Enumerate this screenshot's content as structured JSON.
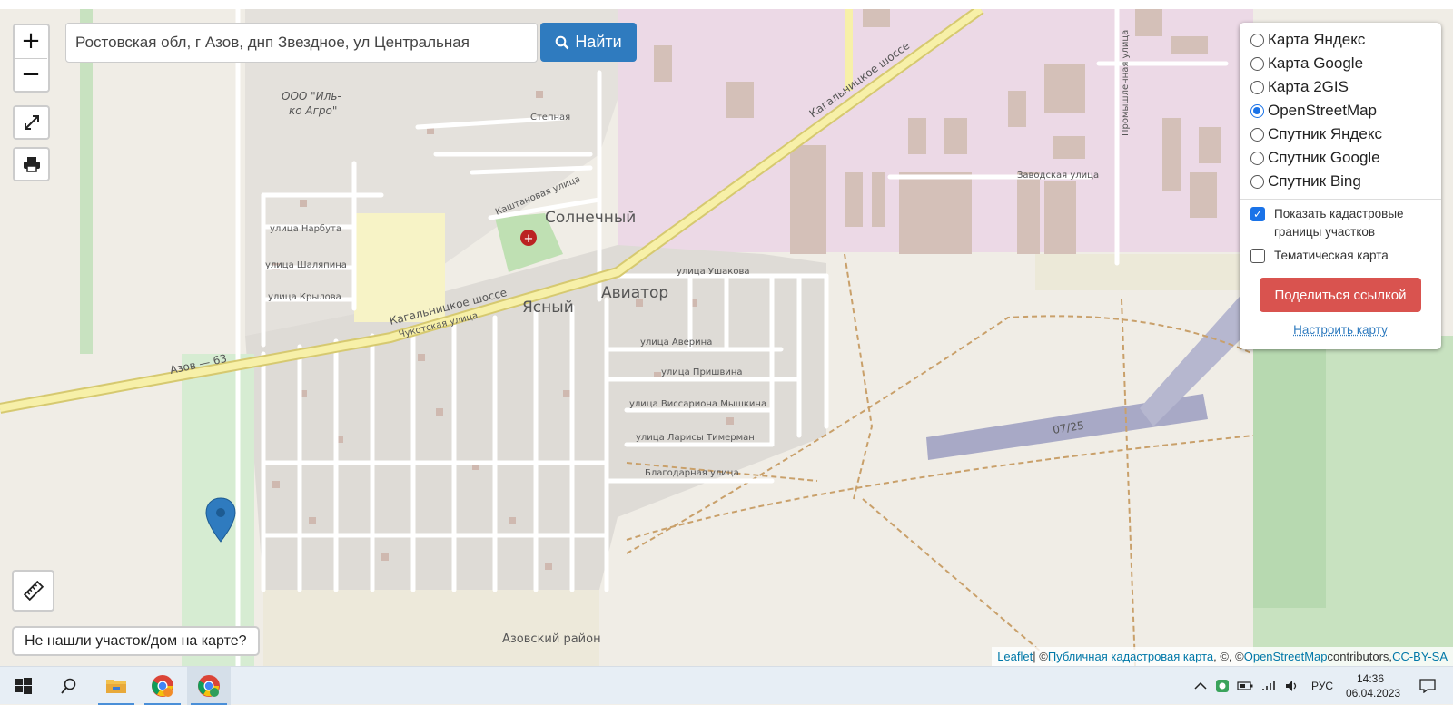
{
  "search": {
    "value": "Ростовская обл, г Азов, днп Звездное, ул Центральная",
    "button_label": "Найти"
  },
  "zoom": {
    "in_label": "+",
    "out_label": "−"
  },
  "layers": {
    "options": [
      {
        "label": "Карта Яндекс",
        "selected": false
      },
      {
        "label": "Карта Google",
        "selected": false
      },
      {
        "label": "Карта 2GIS",
        "selected": false
      },
      {
        "label": "OpenStreetMap",
        "selected": true
      },
      {
        "label": "Спутник Яндекс",
        "selected": false
      },
      {
        "label": "Спутник Google",
        "selected": false
      },
      {
        "label": "Спутник Bing",
        "selected": false
      }
    ],
    "cadastral_label": "Показать кадастровые границы участков",
    "cadastral_checked": true,
    "thematic_label": "Тематическая карта",
    "thematic_checked": false,
    "share_label": "Поделиться ссылкой",
    "config_label": "Настроить карту"
  },
  "notfound_label": "Не нашли участок/дом на карте?",
  "attribution": {
    "leaflet": "Leaflet",
    "sep1": " | © ",
    "cadastral": "Публичная кадастровая карта",
    "sep2": ", ©, © ",
    "osm": "OpenStreetMap",
    "sep3": " contributors, ",
    "license": "CC-BY-SA"
  },
  "map_labels": {
    "place_solnechny": "Солнечный",
    "place_yasny": "Ясный",
    "place_aviator": "Авиатор",
    "highway_1": "Кагальницкое шоссе",
    "highway_2": "Кагальницкое шоссе",
    "road_ref": "Азов — 63",
    "company": "ООО \"Иль-",
    "company2": "ко Агро\"",
    "runway": "07/25",
    "district": "Азовский район",
    "streets": [
      "улица Нарбута",
      "улица Шаляпина",
      "улица Крылова",
      "Степная",
      "Каштановая улица",
      "улица Ушакова",
      "улица Аверина",
      "улица Пришвина",
      "улица Виссариона Мышкина",
      "улица Ларисы Тимерман",
      "Благодарная улица",
      "Чукотская улица",
      "Заводская улица",
      "Промышленная улица"
    ]
  },
  "taskbar": {
    "lang": "РУС",
    "time": "14:36",
    "date": "06.04.2023"
  }
}
